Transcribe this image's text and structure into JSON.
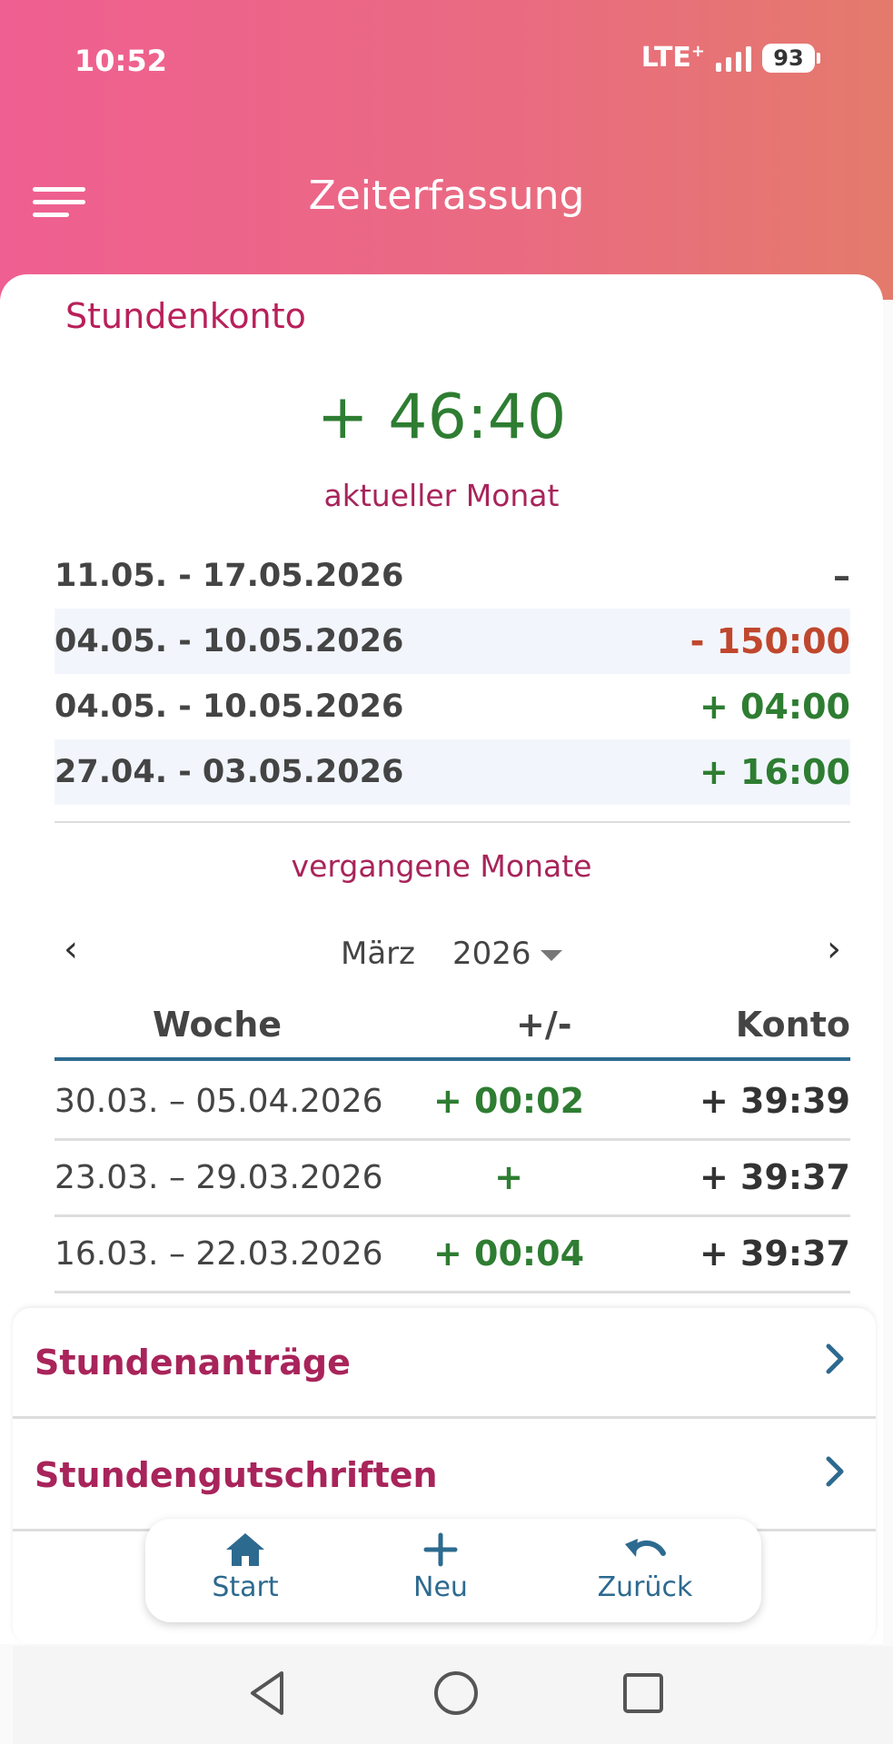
{
  "status": {
    "time": "10:52",
    "network": "LTE",
    "network_sup": "+",
    "battery": "93"
  },
  "appbar": {
    "title": "Zeiterfassung"
  },
  "account": {
    "title": "Stundenkonto",
    "balance": "+ 46:40",
    "current_month_label": "aktueller Monat",
    "weeks": [
      {
        "dates": "11.05. - 17.05.2026",
        "value": "–"
      },
      {
        "dates": "04.05. - 10.05.2026",
        "value": "- 150:00"
      },
      {
        "dates": "04.05. - 10.05.2026",
        "value": "+ 04:00"
      },
      {
        "dates": "27.04. - 03.05.2026",
        "value": "+ 16:00"
      }
    ],
    "past_months_label": "vergangene Monate"
  },
  "month_nav": {
    "month": "März",
    "year": "2026",
    "prev": "‹",
    "next": "›"
  },
  "table": {
    "headers": {
      "week": "Woche",
      "delta": "+/-",
      "konto": "Konto"
    },
    "rows": [
      {
        "week": "30.03. – 05.04.2026",
        "delta": "+ 00:02",
        "konto": "+ 39:39"
      },
      {
        "week": "23.03. – 29.03.2026",
        "delta": "+",
        "konto": "+ 39:37"
      },
      {
        "week": "16.03. – 22.03.2026",
        "delta": "+ 00:04",
        "konto": "+ 39:37"
      }
    ]
  },
  "links": [
    {
      "label": "Stundenanträge",
      "icon": "chevron-right-icon"
    },
    {
      "label": "Stundengutschriften",
      "icon": "chevron-right-icon"
    }
  ],
  "bottom_nav": {
    "start": {
      "label": "Start",
      "icon": "home-icon"
    },
    "neu": {
      "label": "Neu",
      "icon": "plus-icon"
    },
    "zurueck": {
      "label": "Zurück",
      "icon": "undo-icon"
    }
  },
  "colors": {
    "accent": "#b8205a",
    "positive": "#2e7d32",
    "negative": "#c0472d",
    "nav": "#2d6a8f"
  }
}
